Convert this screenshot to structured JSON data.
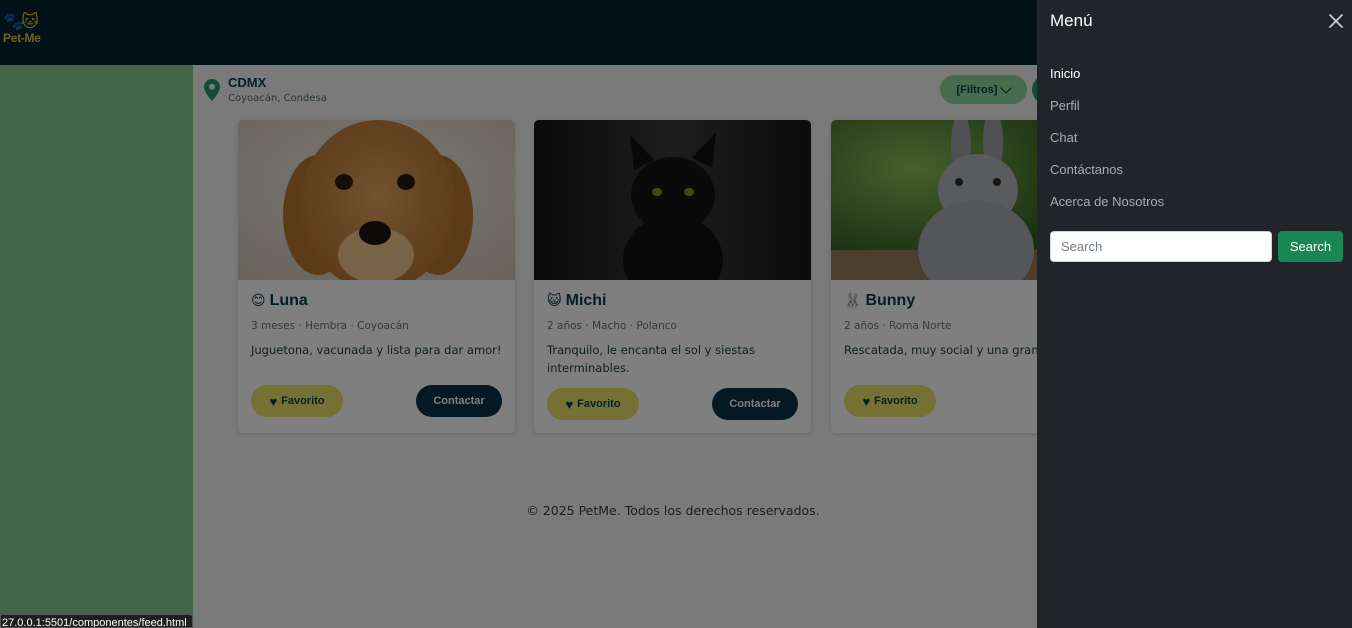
{
  "header": {
    "logo_text": "Pet-Me",
    "logo_paws": "🐾🐱"
  },
  "location": {
    "city": "CDMX",
    "neighborhoods": "Coyoacán, Condesa"
  },
  "filters": {
    "label": "[Filtros]"
  },
  "pets": [
    {
      "emoji": "😊",
      "name": "Luna",
      "meta": "3 meses · Hembra · Coyoacán",
      "description": "Juguetona, vacunada y lista para dar amor!",
      "favorite_label": "Favorito",
      "contact_label": "Contactar"
    },
    {
      "emoji": "😺",
      "name": "Michi",
      "meta": "2 años · Macho · Polanco",
      "description": "Tranquilo, le encanta el sol y siestas interminables.",
      "favorite_label": "Favorito",
      "contact_label": "Contactar"
    },
    {
      "emoji": "🐰",
      "name": "Bunny",
      "meta": "2 años · Roma Norte",
      "description": "Rescatada, muy social y una gran",
      "favorite_label": "Favorito",
      "contact_label": "Co"
    }
  ],
  "footer": {
    "text": "© 2025 PetMe. Todos los derechos reservados."
  },
  "menu": {
    "title": "Menú",
    "items": [
      {
        "label": "Inicio",
        "active": true
      },
      {
        "label": "Perfil",
        "active": false
      },
      {
        "label": "Chat",
        "active": false
      },
      {
        "label": "Contáctanos",
        "active": false
      },
      {
        "label": "Acerca de Nosotros",
        "active": false
      }
    ],
    "search_placeholder": "Search",
    "search_button": "Search"
  },
  "status_url": "27.0.0.1:5501/componentes/feed.html",
  "colors": {
    "header_bg": "#022230",
    "side_strip": "#85c990",
    "accent_green": "#198754",
    "favorite_yellow": "#ebe36a",
    "contact_navy": "#0b3346",
    "menu_bg": "#212529"
  }
}
